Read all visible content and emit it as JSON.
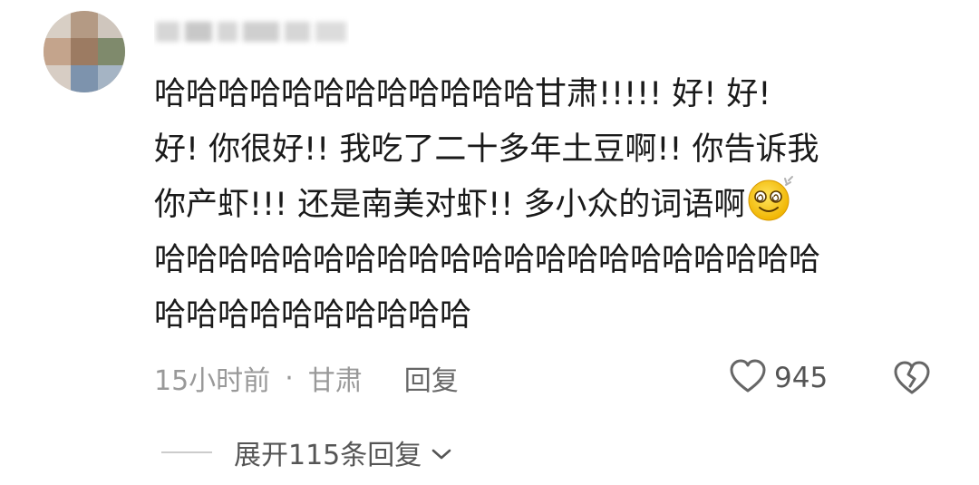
{
  "comment": {
    "user": {
      "avatar": "blurred-avatar",
      "name_hidden": true
    },
    "text_lines": [
      "哈哈哈哈哈哈哈哈哈哈哈哈甘肃!!!!! 好! 好!",
      "好! 你很好!! 我吃了二十多年土豆啊!! 你告诉我",
      "你产虾!!! 还是南美对虾!! 多小众的词语啊",
      "哈哈哈哈哈哈哈哈哈哈哈哈哈哈哈哈哈哈哈哈哈",
      "哈哈哈哈哈哈哈哈哈哈"
    ],
    "emoji": "dizzy-smile-emoji",
    "time": "15小时前",
    "separator": "·",
    "location": "甘肃",
    "reply_label": "回复",
    "like_count": "945",
    "expand_label": "展开115条回复"
  },
  "colors": {
    "text": "#1a1a1a",
    "meta": "#999999",
    "reply": "#666666",
    "icon": "#666666"
  }
}
